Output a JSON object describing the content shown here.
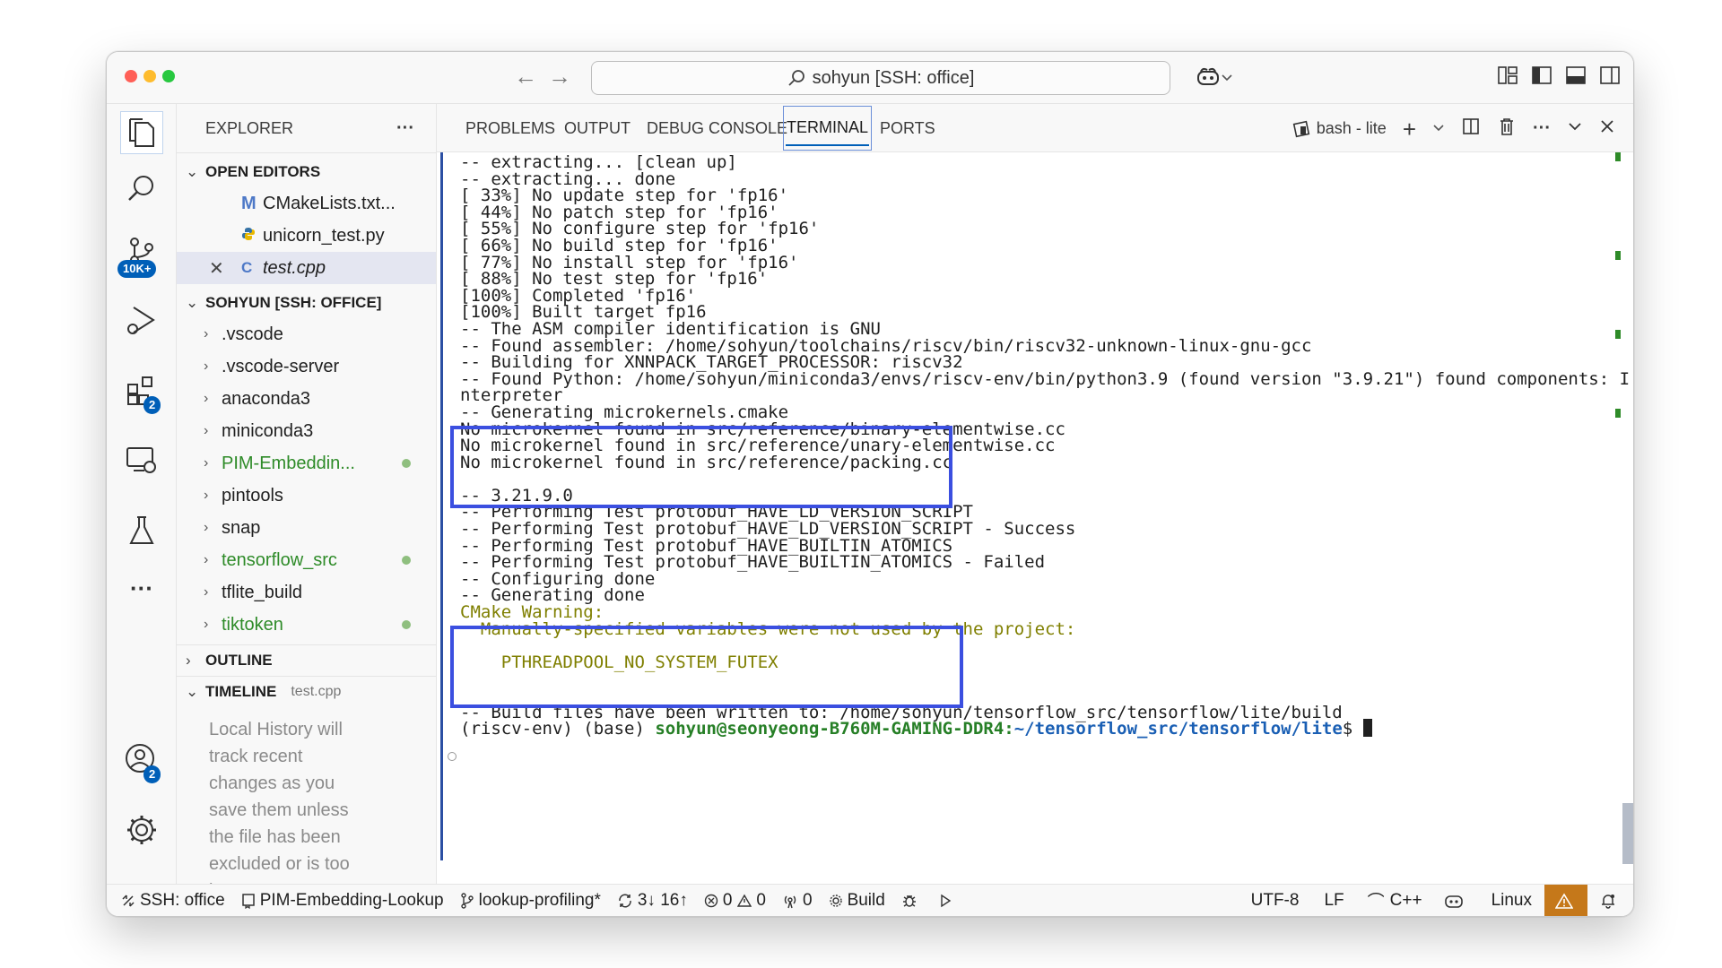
{
  "titlebar": {
    "search_label": "sohyun [SSH: office]",
    "back_icon": "arrow-left-icon",
    "forward_icon": "arrow-right-icon"
  },
  "activity": {
    "source_control_badge": "10K+",
    "extensions_badge": "2",
    "accounts_badge": "2"
  },
  "sidebar": {
    "title": "EXPLORER",
    "more": "···",
    "open_editors_title": "OPEN EDITORS",
    "open_editors": [
      {
        "name": "CMakeLists.txt...",
        "icon": "M"
      },
      {
        "name": "unicorn_test.py",
        "icon": "python-icon"
      },
      {
        "name": "test.cpp",
        "icon": "cpp-icon",
        "close": "✕"
      }
    ],
    "workspace_title": "SOHYUN [SSH: OFFICE]",
    "folders": [
      {
        "name": ".vscode",
        "modified": false
      },
      {
        "name": ".vscode-server",
        "modified": false
      },
      {
        "name": "anaconda3",
        "modified": false
      },
      {
        "name": "miniconda3",
        "modified": false
      },
      {
        "name": "PIM-Embeddin...",
        "modified": true
      },
      {
        "name": "pintools",
        "modified": false
      },
      {
        "name": "snap",
        "modified": false
      },
      {
        "name": "tensorflow_src",
        "modified": true
      },
      {
        "name": "tflite_build",
        "modified": false
      },
      {
        "name": "tiktoken",
        "modified": true
      }
    ],
    "outline_title": "OUTLINE",
    "timeline_title": "TIMELINE",
    "timeline_file": "test.cpp",
    "timeline_lines": [
      "Local History will",
      "track recent",
      "changes as you",
      "save them unless",
      "the file has been",
      "excluded or is too",
      "large."
    ]
  },
  "panel": {
    "tabs": [
      "PROBLEMS",
      "OUTPUT",
      "DEBUG CONSOLE",
      "TERMINAL",
      "PORTS"
    ],
    "active_tab": "TERMINAL",
    "terminal_name": "bash - lite"
  },
  "terminal": {
    "lines": [
      "-- extracting... [clean up]",
      "-- extracting... done",
      "[ 33%] No update step for 'fp16'",
      "[ 44%] No patch step for 'fp16'",
      "[ 55%] No configure step for 'fp16'",
      "[ 66%] No build step for 'fp16'",
      "[ 77%] No install step for 'fp16'",
      "[ 88%] No test step for 'fp16'",
      "[100%] Completed 'fp16'",
      "[100%] Built target fp16",
      "-- The ASM compiler identification is GNU",
      "-- Found assembler: /home/sohyun/toolchains/riscv/bin/riscv32-unknown-linux-gnu-gcc",
      "-- Building for XNNPACK_TARGET_PROCESSOR: riscv32",
      "-- Found Python: /home/sohyun/miniconda3/envs/riscv-env/bin/python3.9 (found version \"3.9.21\") found components: I",
      "nterpreter",
      "-- Generating microkernels.cmake",
      "No microkernel found in src/reference/binary-elementwise.cc",
      "No microkernel found in src/reference/unary-elementwise.cc",
      "No microkernel found in src/reference/packing.cc",
      "",
      "-- 3.21.9.0",
      "-- Performing Test protobuf_HAVE_LD_VERSION_SCRIPT",
      "-- Performing Test protobuf_HAVE_LD_VERSION_SCRIPT - Success",
      "-- Performing Test protobuf_HAVE_BUILTIN_ATOMICS",
      "-- Performing Test protobuf_HAVE_BUILTIN_ATOMICS - Failed",
      "-- Configuring done",
      "-- Generating done"
    ],
    "warning_lines": [
      "CMake Warning:",
      "  Manually-specified variables were not used by the project:",
      "",
      "    PTHREADPOOL_NO_SYSTEM_FUTEX"
    ],
    "tail_lines": [
      "",
      "",
      "-- Build files have been written to: /home/sohyun/tensorflow_src/tensorflow/lite/build"
    ],
    "prompt_env": "(riscv-env) (base) ",
    "prompt_user": "sohyun@seonyeong-B760M-GAMING-DDR4",
    "prompt_sep": ":",
    "prompt_path": "~/tensorflow_src/tensorflow/lite",
    "prompt_end": "$ "
  },
  "statusbar": {
    "remote": "SSH: office",
    "repo": "PIM-Embedding-Lookup",
    "branch": "lookup-profiling*",
    "sync": "3↓ 16↑",
    "errors": "0",
    "warnings": "0",
    "ports": "0",
    "build": "Build",
    "encoding": "UTF-8",
    "eol": "LF",
    "language": "C++",
    "os": "Linux"
  },
  "colors": {
    "highlight_box": "#3b4fe0",
    "git_modified": "#2e8b28",
    "warning_bg": "#c5781a"
  }
}
